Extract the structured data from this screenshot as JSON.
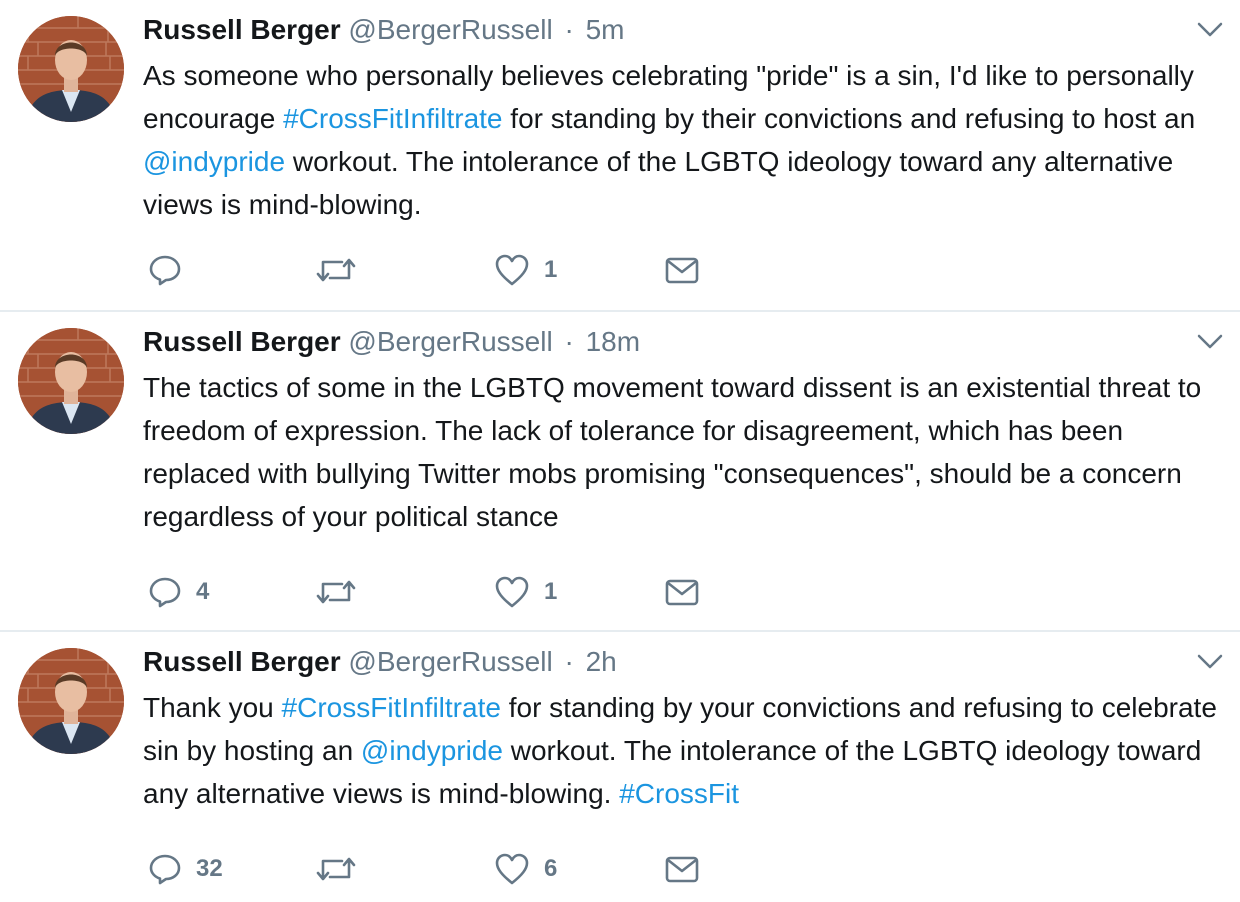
{
  "colors": {
    "link": "#1b95e0",
    "secondary_text": "#657786",
    "primary_text": "#14171a",
    "divider": "#e6ecf0"
  },
  "icons": {
    "reply": "speech-bubble",
    "retweet": "retweet-arrows",
    "like": "heart",
    "dm": "envelope",
    "more": "chevron-down"
  },
  "tweets": [
    {
      "author": "Russell Berger",
      "handle": "@BergerRussell",
      "separator": "·",
      "time": "5m",
      "text": [
        {
          "t": "As someone who personally believes celebrating \"pride\" is a sin, I'd like to personally encourage ",
          "link": false
        },
        {
          "t": "#CrossFitInfiltrate",
          "link": true
        },
        {
          "t": " for standing by their convictions and refusing to host an ",
          "link": false
        },
        {
          "t": "@indypride",
          "link": true
        },
        {
          "t": " workout. The intolerance of the LGBTQ ideology toward any alternative views is mind-blowing.",
          "link": false
        }
      ],
      "replies": "",
      "retweets": "",
      "likes": "1"
    },
    {
      "author": "Russell Berger",
      "handle": "@BergerRussell",
      "separator": "·",
      "time": "18m",
      "text": [
        {
          "t": "The tactics of some in the LGBTQ movement toward dissent is an existential threat to freedom of expression. The lack of tolerance for disagreement, which has been replaced with bullying Twitter mobs promising \"consequences\", should be a concern regardless of your political stance",
          "link": false
        }
      ],
      "replies": "4",
      "retweets": "",
      "likes": "1"
    },
    {
      "author": "Russell Berger",
      "handle": "@BergerRussell",
      "separator": "·",
      "time": "2h",
      "text": [
        {
          "t": "Thank you ",
          "link": false
        },
        {
          "t": "#CrossFitInfiltrate",
          "link": true
        },
        {
          "t": " for standing by your convictions and refusing to celebrate sin by hosting an ",
          "link": false
        },
        {
          "t": "@indypride",
          "link": true
        },
        {
          "t": " workout. The intolerance of the LGBTQ ideology toward any alternative views is mind-blowing. ",
          "link": false
        },
        {
          "t": "#CrossFit",
          "link": true
        }
      ],
      "replies": "32",
      "retweets": "",
      "likes": "6"
    }
  ]
}
